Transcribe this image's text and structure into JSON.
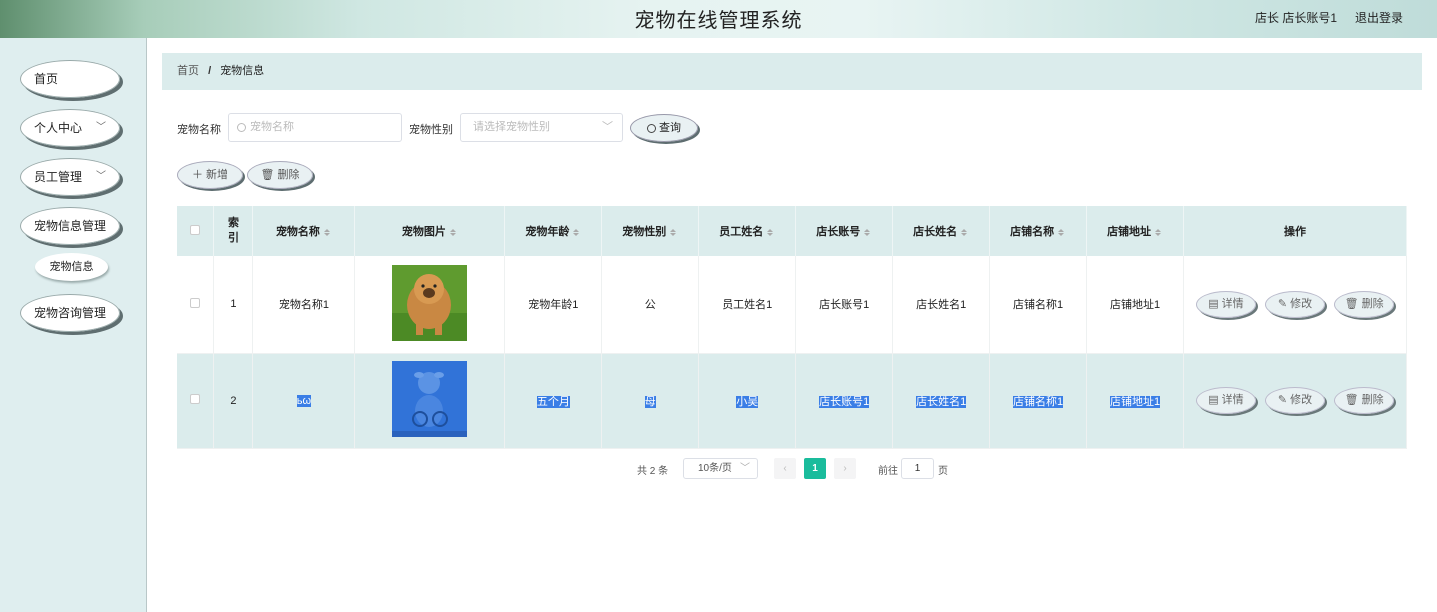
{
  "header": {
    "title": "宠物在线管理系统",
    "user": "店长 店长账号1",
    "logout": "退出登录"
  },
  "sidebar": {
    "items": [
      {
        "label": "首页"
      },
      {
        "label": "个人中心",
        "chevron": "﹀"
      },
      {
        "label": "员工管理",
        "chevron": "﹀"
      },
      {
        "label": "宠物信息管理"
      },
      {
        "label": "宠物咨询管理"
      }
    ],
    "sub_item": "宠物信息"
  },
  "breadcrumb": {
    "home": "首页",
    "sep": "/",
    "current": "宠物信息"
  },
  "search": {
    "name_label": "宠物名称",
    "name_placeholder": "宠物名称",
    "gender_label": "宠物性别",
    "gender_placeholder": "请选择宠物性别",
    "button": "查询"
  },
  "toolbar": {
    "add": "新增",
    "delete": "删除"
  },
  "table": {
    "headers": [
      "索引",
      "宠物名称",
      "宠物图片",
      "宠物年龄",
      "宠物性别",
      "员工姓名",
      "店长账号",
      "店长姓名",
      "店铺名称",
      "店铺地址",
      "操作"
    ],
    "rows": [
      {
        "index": "1",
        "name": "宠物名称1",
        "age": "宠物年龄1",
        "gender": "公",
        "staff": "员工姓名1",
        "manager_account": "店长账号1",
        "manager_name": "店长姓名1",
        "shop_name": "店铺名称1",
        "shop_address": "店铺地址1"
      },
      {
        "index": "2",
        "name": "ьω",
        "age": "五个月",
        "gender": "母",
        "staff": "小吴",
        "manager_account": "店长账号1",
        "manager_name": "店长姓名1",
        "shop_name": "店铺名称1",
        "shop_address": "店铺地址1"
      }
    ],
    "actions": {
      "detail": "详情",
      "edit": "修改",
      "delete": "删除"
    }
  },
  "pagination": {
    "total": "共 2 条",
    "page_size": "10条/页",
    "current_page": "1",
    "goto_label": "前往",
    "goto_value": "1",
    "page_unit": "页"
  },
  "colors": {
    "accent": "#1abc9c",
    "table_header": "#dbecec",
    "sidebar": "#dfeeef",
    "selection": "#3a7ee6"
  }
}
